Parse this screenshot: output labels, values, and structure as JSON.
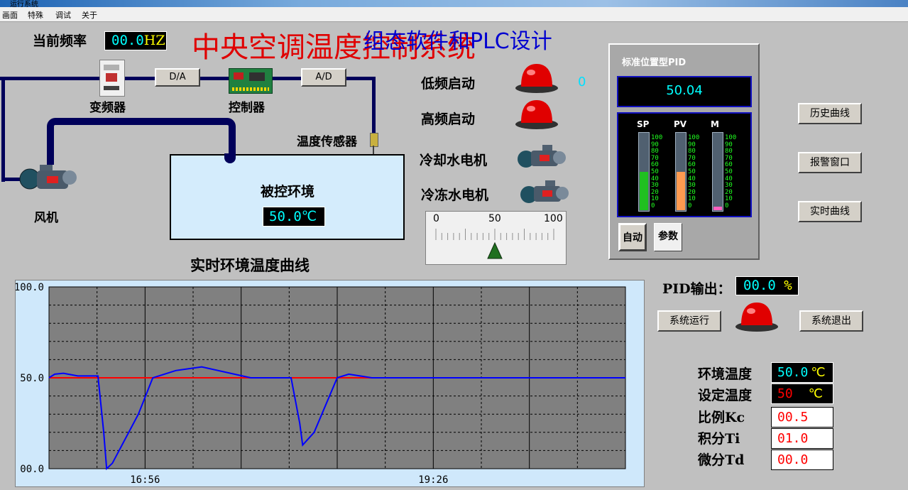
{
  "window": {
    "title": "运行系统"
  },
  "menu": [
    "画面",
    "特殊",
    "调试",
    "关于"
  ],
  "header": {
    "freq_label": "当前频率",
    "freq_value": "00.0",
    "freq_unit": "HZ",
    "title_red": "中央空调温度控制系统",
    "title_blue": "组态软件和PLC设计"
  },
  "diagram": {
    "inverter_label": "变频器",
    "da_label": "D/A",
    "controller_label": "控制器",
    "ad_label": "A/D",
    "sensor_label": "温度传感器",
    "fan_label": "风机",
    "env_label": "被控环境",
    "env_temp": "50.0℃"
  },
  "motors": {
    "low_start": "低频启动",
    "high_start": "高频启动",
    "low_value": "0",
    "cooling_water": "冷却水电机",
    "chilled_water": "冷冻水电机"
  },
  "gauge": {
    "ticks": [
      "0",
      "50",
      "100"
    ],
    "value": 50
  },
  "pid_panel": {
    "title": "标准位置型PID",
    "value": "50.04",
    "bars": [
      {
        "name": "SP",
        "level": 0.5,
        "color": "#20c020"
      },
      {
        "name": "PV",
        "level": 0.5,
        "color": "#ff9a50"
      },
      {
        "name": "M",
        "level": 0.05,
        "color": "#ff60c0"
      }
    ],
    "scale": [
      "100",
      "90",
      "80",
      "70",
      "60",
      "50",
      "40",
      "30",
      "20",
      "10",
      "0"
    ],
    "auto_btn": "自动",
    "param_btn": "参数"
  },
  "right_buttons": {
    "history": "历史曲线",
    "alarm": "报警窗口",
    "realtime": "实时曲线"
  },
  "pid_output": {
    "label": "PID输出：",
    "value": "00.0",
    "unit": "%"
  },
  "system": {
    "run": "系统运行",
    "exit": "系统退出"
  },
  "params": [
    {
      "label": "环境温度",
      "value": "50.0",
      "unit": "℃",
      "style": "dark"
    },
    {
      "label": "设定温度",
      "value": "50",
      "unit": "℃",
      "style": "dark-red"
    },
    {
      "label": "比例Kc",
      "value": "00.5",
      "style": "white"
    },
    {
      "label": "积分Ti",
      "value": "01.0",
      "style": "white"
    },
    {
      "label": "微分Td",
      "value": "00.0",
      "style": "white"
    }
  ],
  "chart_title": "实时环境温度曲线",
  "chart_data": {
    "type": "line",
    "yticks": [
      "100.0",
      "50.0",
      "00.0"
    ],
    "ylim": [
      0,
      100
    ],
    "xticks": [
      "16:56",
      "19:26"
    ],
    "series": [
      {
        "color": "#ff0000",
        "x": [
          0,
          0.35,
          0.56
        ],
        "y": [
          50,
          50,
          50
        ]
      },
      {
        "color": "#0000ff",
        "x": [
          0,
          0.01,
          0.025,
          0.05,
          0.085,
          0.095,
          0.1,
          0.11,
          0.155,
          0.18,
          0.22,
          0.265,
          0.35,
          0.42,
          0.435,
          0.44,
          0.46,
          0.5,
          0.52,
          0.56,
          0.6,
          1.0
        ],
        "y": [
          50,
          52,
          52.5,
          51,
          51,
          20,
          0,
          3,
          30,
          50,
          54,
          56,
          50,
          50,
          25,
          13,
          20,
          50,
          52,
          50,
          50,
          50
        ]
      }
    ]
  }
}
